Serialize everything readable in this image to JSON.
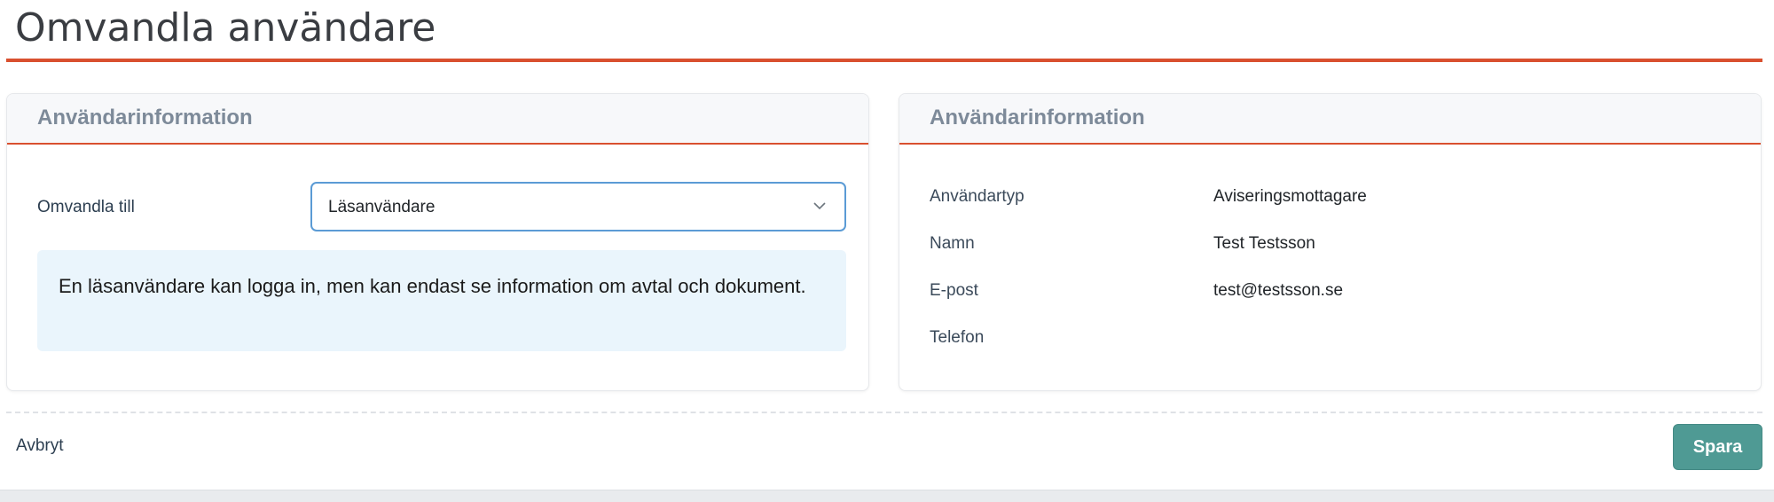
{
  "page": {
    "title": "Omvandla användare"
  },
  "left_card": {
    "title": "Användarinformation",
    "convert_label": "Omvandla till",
    "convert_select": {
      "selected": "Läsanvändare",
      "icon": "chevron-down-icon"
    },
    "info_text": "En läsanvändare kan logga in, men kan endast se information om avtal och dokument."
  },
  "right_card": {
    "title": "Användarinformation",
    "fields": [
      {
        "label": "Användartyp",
        "value": "Aviseringsmottagare"
      },
      {
        "label": "Namn",
        "value": "Test Testsson"
      },
      {
        "label": "E-post",
        "value": "test@testsson.se"
      },
      {
        "label": "Telefon",
        "value": ""
      }
    ]
  },
  "footer": {
    "cancel_label": "Avbryt",
    "save_label": "Spara"
  },
  "colors": {
    "accent_line": "#d9502f",
    "save_button": "#4f9a94",
    "info_background": "#eaf5fc",
    "select_border": "#5b9bd5"
  }
}
